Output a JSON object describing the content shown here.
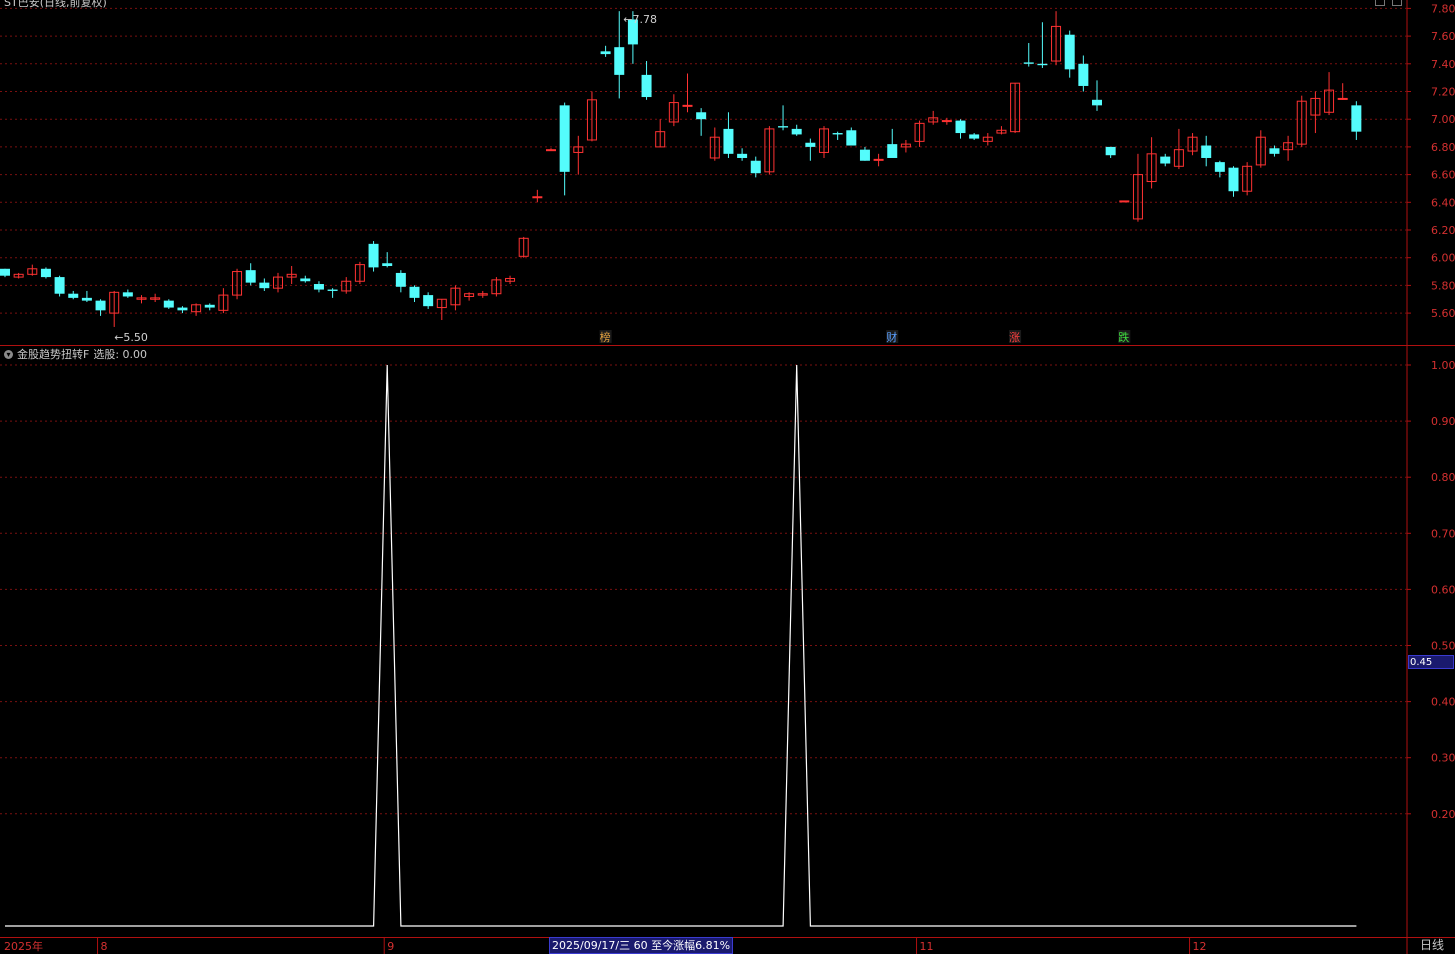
{
  "kline_panel": {
    "title": "ST巴安(日线,前复权)",
    "price_axis": [
      "7.80",
      "7.60",
      "7.40",
      "7.20",
      "7.00",
      "6.80",
      "6.60",
      "6.40",
      "6.20",
      "6.00",
      "5.80",
      "5.60"
    ],
    "high_label": "7.78",
    "low_label": "5.50",
    "markers": [
      {
        "text": "榜",
        "color": "#e0a040"
      },
      {
        "text": "财",
        "color": "#5aa0ff"
      },
      {
        "text": "涨",
        "color": "#ff4040"
      },
      {
        "text": "跌",
        "color": "#40e040"
      }
    ]
  },
  "indicator_panel": {
    "name": "金股趋势扭转F",
    "value_label": "选股: 0.00",
    "axis": [
      "1.00",
      "0.90",
      "0.80",
      "0.70",
      "0.60",
      "0.50",
      "0.40",
      "0.30",
      "0.20"
    ],
    "cursor_value": "0.45"
  },
  "time_axis": {
    "labels": [
      "2025年",
      "8",
      "9",
      "11",
      "12"
    ],
    "status": "2025/09/17/三 60 至今涨幅6.81%"
  },
  "period": "日线",
  "colors": {
    "up": "#ff3232",
    "down": "#54fcfc",
    "grid": "#7a1010",
    "frame": "#b01010",
    "signal": "#ffffff"
  },
  "chart_data": [
    {
      "type": "candlestick",
      "title": "ST巴安(日线,前复权)",
      "ylim": [
        5.5,
        7.8
      ],
      "annotations": [
        {
          "text": "7.78",
          "type": "high"
        },
        {
          "text": "5.50",
          "type": "low"
        }
      ],
      "ohlc": [
        [
          5.92,
          5.92,
          5.86,
          5.87
        ],
        [
          5.86,
          5.89,
          5.85,
          5.88
        ],
        [
          5.88,
          5.95,
          5.87,
          5.92
        ],
        [
          5.92,
          5.93,
          5.85,
          5.86
        ],
        [
          5.86,
          5.87,
          5.72,
          5.74
        ],
        [
          5.74,
          5.76,
          5.7,
          5.71
        ],
        [
          5.71,
          5.76,
          5.68,
          5.69
        ],
        [
          5.69,
          5.7,
          5.58,
          5.62
        ],
        [
          5.6,
          5.76,
          5.5,
          5.75
        ],
        [
          5.75,
          5.77,
          5.71,
          5.72
        ],
        [
          5.7,
          5.73,
          5.67,
          5.71
        ],
        [
          5.7,
          5.74,
          5.68,
          5.71
        ],
        [
          5.69,
          5.7,
          5.63,
          5.64
        ],
        [
          5.64,
          5.65,
          5.6,
          5.62
        ],
        [
          5.61,
          5.67,
          5.58,
          5.66
        ],
        [
          5.66,
          5.67,
          5.62,
          5.64
        ],
        [
          5.62,
          5.78,
          5.6,
          5.73
        ],
        [
          5.73,
          5.92,
          5.7,
          5.9
        ],
        [
          5.91,
          5.96,
          5.8,
          5.82
        ],
        [
          5.82,
          5.85,
          5.76,
          5.78
        ],
        [
          5.78,
          5.89,
          5.75,
          5.86
        ],
        [
          5.86,
          5.94,
          5.81,
          5.88
        ],
        [
          5.85,
          5.87,
          5.82,
          5.83
        ],
        [
          5.81,
          5.83,
          5.75,
          5.77
        ],
        [
          5.77,
          5.78,
          5.71,
          5.76
        ],
        [
          5.76,
          5.86,
          5.74,
          5.83
        ],
        [
          5.83,
          5.97,
          5.81,
          5.95
        ],
        [
          6.1,
          6.12,
          5.9,
          5.93
        ],
        [
          5.96,
          6.04,
          5.93,
          5.94
        ],
        [
          5.89,
          5.91,
          5.75,
          5.79
        ],
        [
          5.79,
          5.8,
          5.68,
          5.71
        ],
        [
          5.73,
          5.75,
          5.63,
          5.65
        ],
        [
          5.64,
          5.7,
          5.55,
          5.7
        ],
        [
          5.66,
          5.8,
          5.62,
          5.78
        ],
        [
          5.72,
          5.75,
          5.69,
          5.74
        ],
        [
          5.73,
          5.76,
          5.71,
          5.74
        ],
        [
          5.74,
          5.86,
          5.72,
          5.84
        ],
        [
          5.83,
          5.87,
          5.81,
          5.85
        ],
        [
          6.01,
          6.15,
          6.0,
          6.14
        ],
        [
          6.44,
          6.49,
          6.4,
          6.44
        ],
        [
          6.78,
          6.79,
          6.78,
          6.78
        ],
        [
          7.1,
          7.12,
          6.45,
          6.62
        ],
        [
          6.76,
          6.88,
          6.6,
          6.8
        ],
        [
          6.85,
          7.2,
          6.84,
          7.14
        ],
        [
          7.49,
          7.53,
          7.45,
          7.47
        ],
        [
          7.52,
          7.78,
          7.15,
          7.32
        ],
        [
          7.72,
          7.78,
          7.4,
          7.54
        ],
        [
          7.32,
          7.42,
          7.14,
          7.16
        ],
        [
          6.8,
          7.0,
          6.8,
          6.91
        ],
        [
          6.98,
          7.18,
          6.95,
          7.12
        ],
        [
          7.1,
          7.33,
          7.05,
          7.1
        ],
        [
          7.05,
          7.08,
          6.88,
          7.0
        ],
        [
          6.72,
          6.94,
          6.7,
          6.87
        ],
        [
          6.93,
          7.05,
          6.72,
          6.75
        ],
        [
          6.75,
          6.79,
          6.7,
          6.72
        ],
        [
          6.7,
          6.73,
          6.58,
          6.61
        ],
        [
          6.62,
          6.95,
          6.6,
          6.93
        ],
        [
          6.95,
          7.1,
          6.92,
          6.94
        ],
        [
          6.93,
          6.96,
          6.88,
          6.89
        ],
        [
          6.83,
          6.86,
          6.7,
          6.8
        ],
        [
          6.76,
          6.95,
          6.72,
          6.93
        ],
        [
          6.9,
          6.91,
          6.85,
          6.89
        ],
        [
          6.92,
          6.94,
          6.81,
          6.81
        ],
        [
          6.78,
          6.8,
          6.7,
          6.7
        ],
        [
          6.71,
          6.75,
          6.66,
          6.71
        ],
        [
          6.82,
          6.93,
          6.75,
          6.72
        ],
        [
          6.8,
          6.85,
          6.76,
          6.82
        ],
        [
          6.84,
          6.99,
          6.8,
          6.97
        ],
        [
          6.98,
          7.06,
          6.96,
          7.01
        ],
        [
          6.99,
          7.01,
          6.96,
          6.99
        ],
        [
          6.99,
          7.0,
          6.86,
          6.9
        ],
        [
          6.89,
          6.9,
          6.85,
          6.86
        ],
        [
          6.84,
          6.9,
          6.81,
          6.87
        ],
        [
          6.9,
          6.95,
          6.89,
          6.92
        ],
        [
          6.91,
          7.26,
          6.9,
          7.26
        ],
        [
          7.41,
          7.55,
          7.38,
          7.4
        ],
        [
          7.4,
          7.7,
          7.37,
          7.39
        ],
        [
          7.42,
          7.78,
          7.39,
          7.67
        ],
        [
          7.61,
          7.64,
          7.3,
          7.36
        ],
        [
          7.4,
          7.46,
          7.2,
          7.24
        ],
        [
          7.14,
          7.28,
          7.06,
          7.1
        ],
        [
          6.8,
          6.8,
          6.72,
          6.74
        ],
        [
          6.41,
          6.41,
          6.4,
          6.41
        ],
        [
          6.28,
          6.75,
          6.26,
          6.6
        ],
        [
          6.55,
          6.87,
          6.5,
          6.75
        ],
        [
          6.73,
          6.75,
          6.66,
          6.68
        ],
        [
          6.66,
          6.93,
          6.64,
          6.78
        ],
        [
          6.77,
          6.9,
          6.74,
          6.87
        ],
        [
          6.81,
          6.88,
          6.66,
          6.72
        ],
        [
          6.69,
          6.7,
          6.58,
          6.62
        ],
        [
          6.65,
          6.66,
          6.44,
          6.48
        ],
        [
          6.48,
          6.69,
          6.45,
          6.66
        ],
        [
          6.67,
          6.92,
          6.65,
          6.87
        ],
        [
          6.79,
          6.81,
          6.73,
          6.75
        ],
        [
          6.78,
          6.88,
          6.7,
          6.83
        ],
        [
          6.82,
          7.17,
          6.8,
          7.13
        ],
        [
          7.03,
          7.2,
          6.9,
          7.15
        ],
        [
          7.05,
          7.34,
          7.03,
          7.21
        ],
        [
          7.15,
          7.26,
          7.14,
          7.15
        ],
        [
          7.1,
          7.13,
          6.85,
          6.91
        ]
      ]
    },
    {
      "type": "line",
      "title": "金股趋势扭转F",
      "ylim": [
        0,
        1
      ],
      "series": [
        {
          "values": [
            0,
            0,
            0,
            0,
            0,
            0,
            0,
            0,
            0,
            0,
            0,
            0,
            0,
            0,
            0,
            0,
            0,
            0,
            0,
            0,
            0,
            0,
            0,
            0,
            0,
            0,
            0,
            0,
            0,
            0,
            0,
            0,
            0,
            0,
            0,
            0,
            0,
            0,
            0,
            0,
            0,
            0,
            0,
            0,
            0,
            0,
            0,
            0,
            0,
            0,
            0,
            0,
            0,
            0,
            0,
            0,
            0,
            0,
            0,
            0,
            0,
            0,
            0,
            0,
            0,
            0,
            0,
            0,
            0,
            0,
            0,
            0,
            0,
            0,
            0,
            0,
            0,
            0,
            0,
            0,
            0,
            0,
            0,
            0,
            0,
            0,
            0,
            0,
            0,
            0,
            0,
            0,
            0,
            0,
            0,
            0,
            0,
            0,
            0,
            0
          ],
          "spikes": [
            28,
            58
          ]
        }
      ]
    }
  ]
}
